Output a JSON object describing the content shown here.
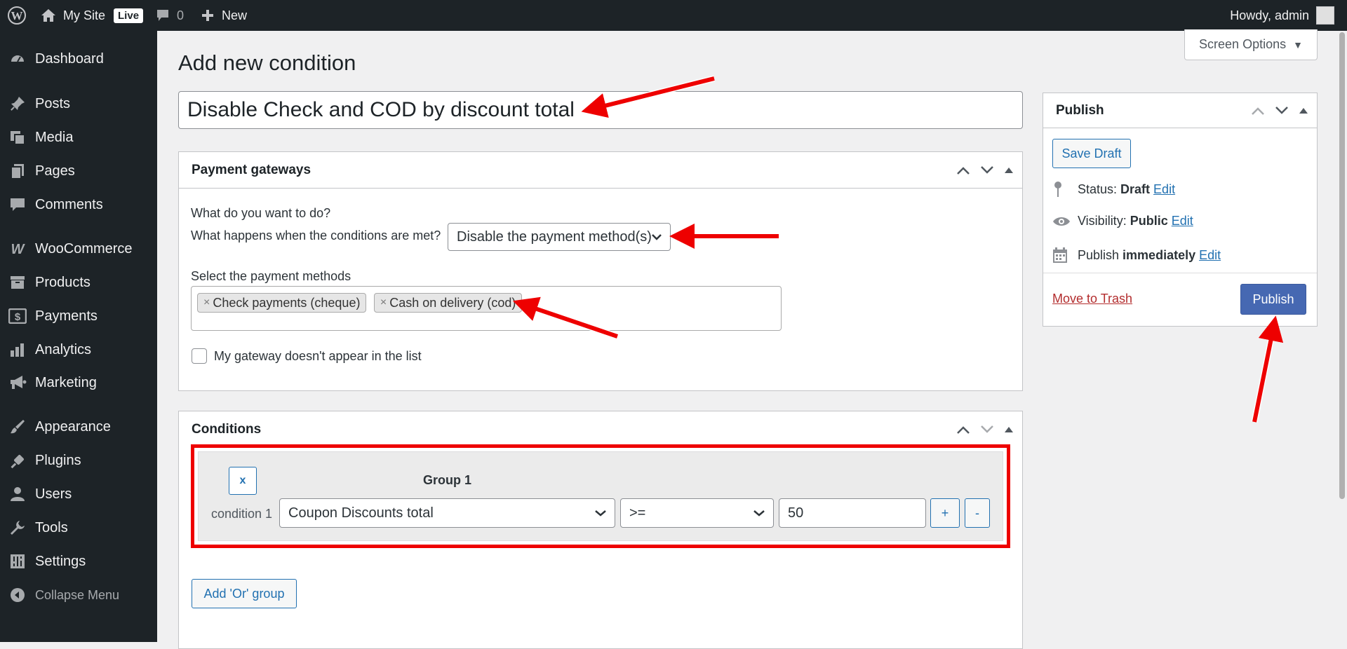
{
  "adminbar": {
    "site_name": "My Site",
    "live_label": "Live",
    "comments_count": "0",
    "new_label": "New",
    "greeting": "Howdy, admin"
  },
  "sidebar": {
    "items": [
      {
        "label": "Dashboard",
        "icon": "dashboard-icon"
      },
      {
        "label": "Posts",
        "icon": "pin-icon"
      },
      {
        "label": "Media",
        "icon": "media-icon"
      },
      {
        "label": "Pages",
        "icon": "pages-icon"
      },
      {
        "label": "Comments",
        "icon": "comment-icon"
      },
      {
        "label": "WooCommerce",
        "icon": "woo-icon"
      },
      {
        "label": "Products",
        "icon": "archive-icon"
      },
      {
        "label": "Payments",
        "icon": "dollar-icon"
      },
      {
        "label": "Analytics",
        "icon": "bar-chart-icon"
      },
      {
        "label": "Marketing",
        "icon": "megaphone-icon"
      },
      {
        "label": "Appearance",
        "icon": "brush-icon"
      },
      {
        "label": "Plugins",
        "icon": "plug-icon"
      },
      {
        "label": "Users",
        "icon": "user-icon"
      },
      {
        "label": "Tools",
        "icon": "wrench-icon"
      },
      {
        "label": "Settings",
        "icon": "settings-icon"
      }
    ],
    "collapse_label": "Collapse Menu"
  },
  "screen_options_label": "Screen Options",
  "page_title": "Add new condition",
  "title_value": "Disable Check and COD by discount total",
  "gateways": {
    "title": "Payment gateways",
    "question": "What do you want to do?",
    "action_label": "What happens when the conditions are met?",
    "action_value": "Disable the payment method(s)",
    "methods_label": "Select the payment methods",
    "methods": [
      "Check payments (cheque)",
      "Cash on delivery (cod)"
    ],
    "checkbox_label": "My gateway doesn't appear in the list"
  },
  "conditions": {
    "title": "Conditions",
    "remove_group_label": "x",
    "group_title": "Group 1",
    "condition_label": "condition 1",
    "field_value": "Coupon Discounts total",
    "operator_value": ">=",
    "amount_value": "50",
    "add_label": "+",
    "remove_label": "-",
    "add_or_group_label": "Add 'Or' group"
  },
  "publish": {
    "title": "Publish",
    "save_draft_label": "Save Draft",
    "status_label": "Status:",
    "status_value": "Draft",
    "visibility_label": "Visibility:",
    "visibility_value": "Public",
    "publish_label": "Publish",
    "publish_value": "immediately",
    "edit_label": "Edit",
    "trash_label": "Move to Trash",
    "publish_button_label": "Publish"
  },
  "annotation_color": "#ee0000"
}
